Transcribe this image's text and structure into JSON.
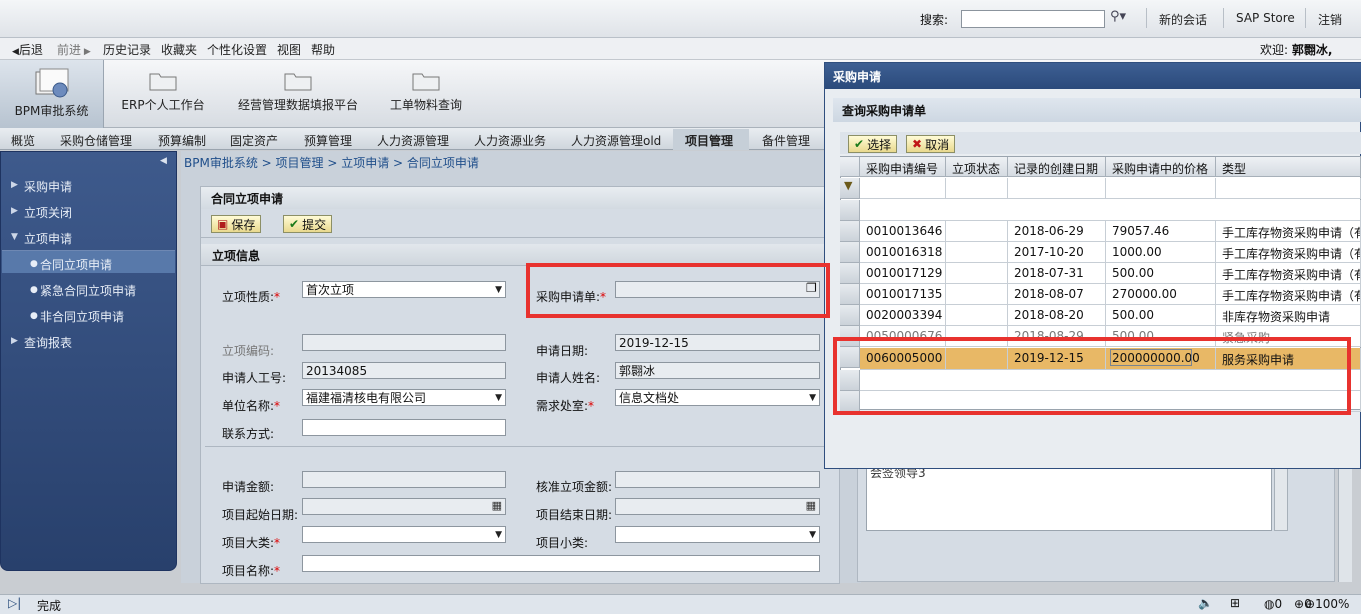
{
  "topbar": {
    "search_label": "搜索:",
    "new_session": "新的会话",
    "sap_store": "SAP Store",
    "logout": "注销"
  },
  "menubar": {
    "back": "后退",
    "forward": "前进",
    "history": "历史记录",
    "favorites": "收藏夹",
    "personalize": "个性化设置",
    "view": "视图",
    "help": "帮助",
    "welcome_prefix": "欢迎:",
    "welcome_user": "郭翾冰,"
  },
  "apps": [
    {
      "label": "BPM审批系统"
    },
    {
      "label": "ERP个人工作台"
    },
    {
      "label": "经营管理数据填报平台"
    },
    {
      "label": "工单物料查询"
    }
  ],
  "tabs": [
    "概览",
    "采购仓储管理",
    "预算编制",
    "固定资产",
    "预算管理",
    "人力资源管理",
    "人力资源业务",
    "人力资源管理old",
    "项目管理",
    "备件管理"
  ],
  "sidebar": {
    "items": [
      "采购申请",
      "立项关闭",
      "立项申请",
      "查询报表"
    ],
    "subitems": [
      "合同立项申请",
      "紧急合同立项申请",
      "非合同立项申请"
    ]
  },
  "breadcrumb": [
    "BPM审批系统",
    "项目管理",
    "立项申请",
    "合同立项申请"
  ],
  "form": {
    "title": "合同立项申请",
    "save": "保存",
    "submit": "提交",
    "section": "立项信息",
    "nature_label": "立项性质:",
    "nature_value": "首次立项",
    "pr_label": "采购申请单:",
    "code_label": "立项编码:",
    "date_label": "申请日期:",
    "date_value": "2019-12-15",
    "emp_no_label": "申请人工号:",
    "emp_no_value": "20134085",
    "emp_name_label": "申请人姓名:",
    "emp_name_value": "郭翾冰",
    "unit_label": "单位名称:",
    "unit_value": "福建福清核电有限公司",
    "dept_label": "需求处室:",
    "dept_value": "信息文档处",
    "contact_label": "联系方式:",
    "amount_label": "申请金额:",
    "approved_label": "核准立项金额:",
    "start_label": "项目起始日期:",
    "end_label": "项目结束日期:",
    "major_label": "项目大类:",
    "minor_label": "项目小类:",
    "name_label": "项目名称:"
  },
  "rightpanel": {
    "fragment": "会签领导3"
  },
  "dialog": {
    "title": "采购申请",
    "subtitle": "查询采购申请单",
    "select": "选择",
    "cancel": "取消",
    "columns": [
      "采购申请编号",
      "立项状态",
      "记录的创建日期",
      "采购申请中的价格",
      "类型"
    ],
    "rows": [
      {
        "id": "0010013646",
        "status": "",
        "date": "2018-06-29",
        "price": "79057.46",
        "type": "手工库存物资采购申请（有"
      },
      {
        "id": "0010016318",
        "status": "",
        "date": "2017-10-20",
        "price": "1000.00",
        "type": "手工库存物资采购申请（有"
      },
      {
        "id": "0010017129",
        "status": "",
        "date": "2018-07-31",
        "price": "500.00",
        "type": "手工库存物资采购申请（有"
      },
      {
        "id": "0010017135",
        "status": "",
        "date": "2018-08-07",
        "price": "270000.00",
        "type": "手工库存物资采购申请（有"
      },
      {
        "id": "0020003394",
        "status": "",
        "date": "2018-08-20",
        "price": "500.00",
        "type": "非库存物资采购申请"
      },
      {
        "id": "0050000676",
        "status": "",
        "date": "2018-08-29",
        "price": "500.00",
        "type": "紧急采购"
      },
      {
        "id": "0060005000",
        "status": "",
        "date": "2019-12-15",
        "price": "200000000.00",
        "type": "服务采购申请"
      }
    ]
  },
  "status": {
    "done": "完成",
    "zone_a": "0",
    "zone_b": "0",
    "zoom": "100%"
  }
}
